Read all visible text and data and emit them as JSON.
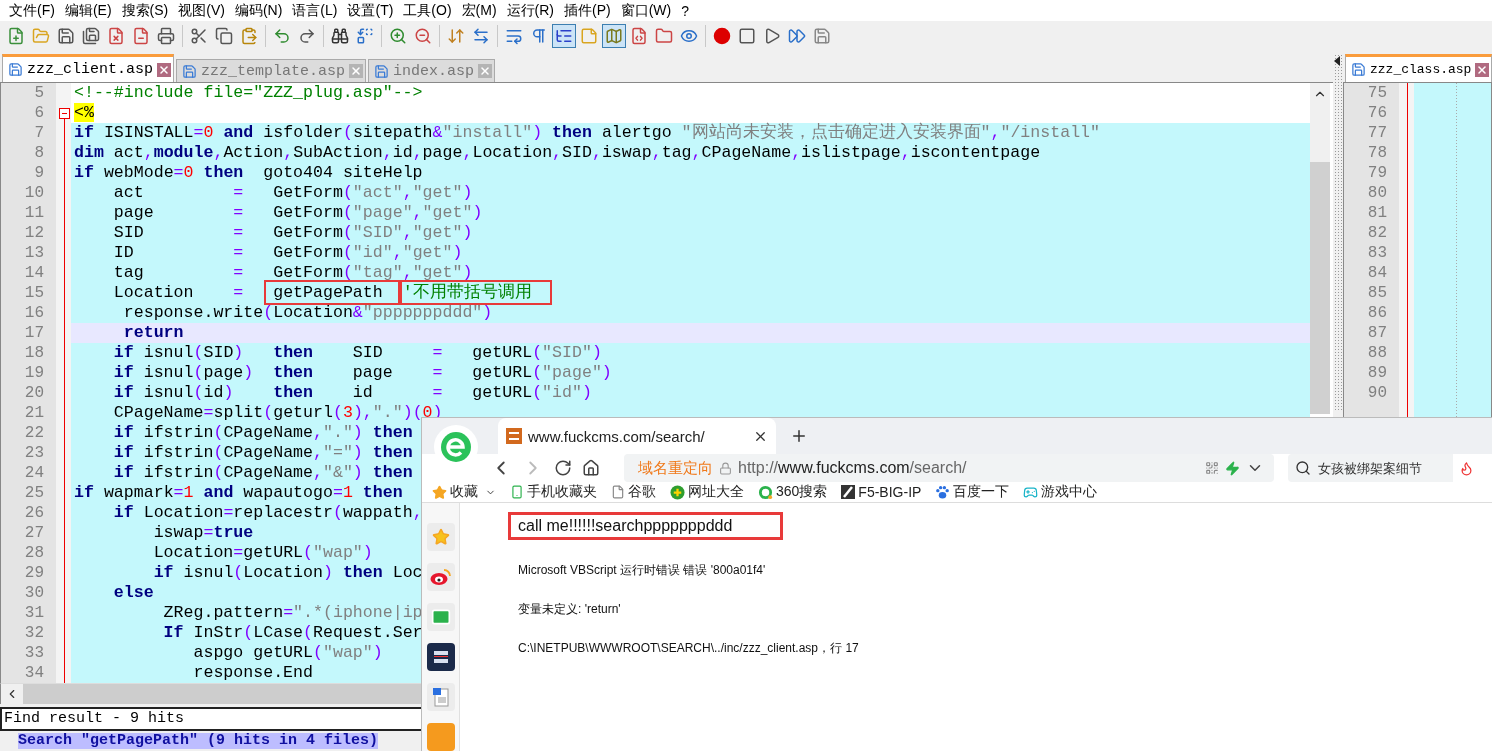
{
  "menu": [
    "文件(F)",
    "编辑(E)",
    "搜索(S)",
    "视图(V)",
    "编码(N)",
    "语言(L)",
    "设置(T)",
    "工具(O)",
    "宏(M)",
    "运行(R)",
    "插件(P)",
    "窗口(W)",
    "?"
  ],
  "toolbar": [
    [
      {
        "kind": "new",
        "pressed": false
      },
      {
        "kind": "open",
        "pressed": false
      },
      {
        "kind": "save",
        "pressed": false
      },
      {
        "kind": "saveall",
        "pressed": false
      },
      {
        "kind": "close",
        "pressed": false
      },
      {
        "kind": "closeall",
        "pressed": false
      },
      {
        "kind": "print",
        "pressed": false
      }
    ],
    [
      {
        "kind": "cut",
        "pressed": false
      },
      {
        "kind": "copy",
        "pressed": false
      },
      {
        "kind": "paste",
        "pressed": false
      }
    ],
    [
      {
        "kind": "undo",
        "pressed": false
      },
      {
        "kind": "redo",
        "pressed": false
      }
    ],
    [
      {
        "kind": "find",
        "pressed": false
      },
      {
        "kind": "replace",
        "pressed": false
      }
    ],
    [
      {
        "kind": "zoomin",
        "pressed": false
      },
      {
        "kind": "zoomout",
        "pressed": false
      }
    ],
    [
      {
        "kind": "syncv",
        "pressed": false
      },
      {
        "kind": "synch",
        "pressed": false
      }
    ],
    [
      {
        "kind": "wrap",
        "pressed": false
      },
      {
        "kind": "chars",
        "pressed": false
      },
      {
        "kind": "guide",
        "pressed": true
      },
      {
        "kind": "note",
        "pressed": false
      },
      {
        "kind": "map",
        "pressed": true
      },
      {
        "kind": "func",
        "pressed": false
      },
      {
        "kind": "folder",
        "pressed": false
      },
      {
        "kind": "eye",
        "pressed": false
      }
    ],
    [
      {
        "kind": "record",
        "pressed": false
      },
      {
        "kind": "stop",
        "pressed": false
      },
      {
        "kind": "play",
        "pressed": false
      },
      {
        "kind": "playmany",
        "pressed": false
      },
      {
        "kind": "savemacro",
        "pressed": false
      }
    ]
  ],
  "tabs": [
    {
      "label": "zzz_client.asp",
      "selected": true
    },
    {
      "label": "zzz_template.asp",
      "selected": false
    },
    {
      "label": "index.asp",
      "selected": false
    }
  ],
  "editor": {
    "lines": [
      {
        "n": "5",
        "embedded": false,
        "current": false,
        "fold": false,
        "tokens": [
          {
            "kind": "markup",
            "text": "<!--#include file=\"ZZZ_plug.asp\"-->"
          }
        ]
      },
      {
        "n": "6",
        "embedded": false,
        "current": false,
        "fold": true,
        "tokens": [
          {
            "kind": "delimiter",
            "text": "<%"
          }
        ]
      },
      {
        "n": "7",
        "embedded": true,
        "current": false,
        "fold": false,
        "tokens": [
          {
            "kind": "keyword",
            "text": "if"
          },
          {
            "kind": "plain",
            "text": " ISINSTALL"
          },
          {
            "kind": "operator",
            "text": "="
          },
          {
            "kind": "number",
            "text": "0"
          },
          {
            "kind": "keyword",
            "text": " and"
          },
          {
            "kind": "plain",
            "text": " isfolder"
          },
          {
            "kind": "operator",
            "text": "("
          },
          {
            "kind": "plain",
            "text": "sitepath"
          },
          {
            "kind": "operator",
            "text": "&"
          },
          {
            "kind": "string",
            "text": "\"install\""
          },
          {
            "kind": "operator",
            "text": ")"
          },
          {
            "kind": "keyword",
            "text": " then"
          },
          {
            "kind": "plain",
            "text": " alertgo "
          },
          {
            "kind": "string",
            "text": "\"网站尚未安装，点击确定进入安装界面\""
          },
          {
            "kind": "operator",
            "text": ","
          },
          {
            "kind": "string",
            "text": "\"/install\""
          }
        ]
      },
      {
        "n": "8",
        "embedded": true,
        "current": false,
        "fold": false,
        "tokens": [
          {
            "kind": "keyword",
            "text": "dim"
          },
          {
            "kind": "plain",
            "text": " act"
          },
          {
            "kind": "operator",
            "text": ","
          },
          {
            "kind": "keyword",
            "text": "module"
          },
          {
            "kind": "operator",
            "text": ","
          },
          {
            "kind": "plain",
            "text": "Action"
          },
          {
            "kind": "operator",
            "text": ","
          },
          {
            "kind": "plain",
            "text": "SubAction"
          },
          {
            "kind": "operator",
            "text": ","
          },
          {
            "kind": "plain",
            "text": "id"
          },
          {
            "kind": "operator",
            "text": ","
          },
          {
            "kind": "plain",
            "text": "page"
          },
          {
            "kind": "operator",
            "text": ","
          },
          {
            "kind": "plain",
            "text": "Location"
          },
          {
            "kind": "operator",
            "text": ","
          },
          {
            "kind": "plain",
            "text": "SID"
          },
          {
            "kind": "operator",
            "text": ","
          },
          {
            "kind": "plain",
            "text": "iswap"
          },
          {
            "kind": "operator",
            "text": ","
          },
          {
            "kind": "plain",
            "text": "tag"
          },
          {
            "kind": "operator",
            "text": ","
          },
          {
            "kind": "plain",
            "text": "CPageName"
          },
          {
            "kind": "operator",
            "text": ","
          },
          {
            "kind": "plain",
            "text": "islistpage"
          },
          {
            "kind": "operator",
            "text": ","
          },
          {
            "kind": "plain",
            "text": "iscontentpage"
          }
        ]
      },
      {
        "n": "9",
        "embedded": true,
        "current": false,
        "fold": false,
        "tokens": [
          {
            "kind": "keyword",
            "text": "if"
          },
          {
            "kind": "plain",
            "text": " webMode"
          },
          {
            "kind": "operator",
            "text": "="
          },
          {
            "kind": "number",
            "text": "0"
          },
          {
            "kind": "keyword",
            "text": " then"
          },
          {
            "kind": "plain",
            "text": "  goto404 siteHelp"
          }
        ]
      },
      {
        "n": "10",
        "embedded": true,
        "current": false,
        "fold": false,
        "tokens": [
          {
            "kind": "plain",
            "text": "    act         "
          },
          {
            "kind": "operator",
            "text": "="
          },
          {
            "kind": "plain",
            "text": "   GetForm"
          },
          {
            "kind": "operator",
            "text": "("
          },
          {
            "kind": "string",
            "text": "\"act\""
          },
          {
            "kind": "operator",
            "text": ","
          },
          {
            "kind": "string",
            "text": "\"get\""
          },
          {
            "kind": "operator",
            "text": ")"
          }
        ]
      },
      {
        "n": "11",
        "embedded": true,
        "current": false,
        "fold": false,
        "tokens": [
          {
            "kind": "plain",
            "text": "    page        "
          },
          {
            "kind": "operator",
            "text": "="
          },
          {
            "kind": "plain",
            "text": "   GetForm"
          },
          {
            "kind": "operator",
            "text": "("
          },
          {
            "kind": "string",
            "text": "\"page\""
          },
          {
            "kind": "operator",
            "text": ","
          },
          {
            "kind": "string",
            "text": "\"get\""
          },
          {
            "kind": "operator",
            "text": ")"
          }
        ]
      },
      {
        "n": "12",
        "embedded": true,
        "current": false,
        "fold": false,
        "tokens": [
          {
            "kind": "plain",
            "text": "    SID         "
          },
          {
            "kind": "operator",
            "text": "="
          },
          {
            "kind": "plain",
            "text": "   GetForm"
          },
          {
            "kind": "operator",
            "text": "("
          },
          {
            "kind": "string",
            "text": "\"SID\""
          },
          {
            "kind": "operator",
            "text": ","
          },
          {
            "kind": "string",
            "text": "\"get\""
          },
          {
            "kind": "operator",
            "text": ")"
          }
        ]
      },
      {
        "n": "13",
        "embedded": true,
        "current": false,
        "fold": false,
        "tokens": [
          {
            "kind": "plain",
            "text": "    ID          "
          },
          {
            "kind": "operator",
            "text": "="
          },
          {
            "kind": "plain",
            "text": "   GetForm"
          },
          {
            "kind": "operator",
            "text": "("
          },
          {
            "kind": "string",
            "text": "\"id\""
          },
          {
            "kind": "operator",
            "text": ","
          },
          {
            "kind": "string",
            "text": "\"get\""
          },
          {
            "kind": "operator",
            "text": ")"
          }
        ]
      },
      {
        "n": "14",
        "embedded": true,
        "current": false,
        "fold": false,
        "tokens": [
          {
            "kind": "plain",
            "text": "    tag         "
          },
          {
            "kind": "operator",
            "text": "="
          },
          {
            "kind": "plain",
            "text": "   GetForm"
          },
          {
            "kind": "operator",
            "text": "("
          },
          {
            "kind": "string",
            "text": "\"tag\""
          },
          {
            "kind": "operator",
            "text": ","
          },
          {
            "kind": "string",
            "text": "\"get\""
          },
          {
            "kind": "operator",
            "text": ")"
          }
        ]
      },
      {
        "n": "15",
        "embedded": true,
        "current": false,
        "fold": false,
        "tokens": [
          {
            "kind": "plain",
            "text": "    Location    "
          },
          {
            "kind": "operator",
            "text": "=   "
          },
          {
            "kind": "plain",
            "text": "getPagePath  ",
            "boxed": true
          },
          {
            "kind": "comment",
            "text": "'不用带括号调用",
            "boxed": true
          }
        ]
      },
      {
        "n": "16",
        "embedded": true,
        "current": false,
        "fold": false,
        "tokens": [
          {
            "kind": "plain",
            "text": "     response.write"
          },
          {
            "kind": "operator",
            "text": "("
          },
          {
            "kind": "plain",
            "text": "Location"
          },
          {
            "kind": "operator",
            "text": "&"
          },
          {
            "kind": "string",
            "text": "\"pppppppddd\""
          },
          {
            "kind": "operator",
            "text": ")"
          }
        ]
      },
      {
        "n": "17",
        "embedded": true,
        "current": true,
        "fold": false,
        "tokens": [
          {
            "kind": "keyword",
            "text": "     return"
          }
        ]
      },
      {
        "n": "18",
        "embedded": true,
        "current": false,
        "fold": false,
        "tokens": [
          {
            "kind": "keyword",
            "text": "    if"
          },
          {
            "kind": "plain",
            "text": " isnul"
          },
          {
            "kind": "operator",
            "text": "("
          },
          {
            "kind": "plain",
            "text": "SID"
          },
          {
            "kind": "operator",
            "text": ")"
          },
          {
            "kind": "keyword",
            "text": "   then"
          },
          {
            "kind": "plain",
            "text": "    SID     "
          },
          {
            "kind": "operator",
            "text": "="
          },
          {
            "kind": "plain",
            "text": "   getURL"
          },
          {
            "kind": "operator",
            "text": "("
          },
          {
            "kind": "string",
            "text": "\"SID\""
          },
          {
            "kind": "operator",
            "text": ")"
          }
        ]
      },
      {
        "n": "19",
        "embedded": true,
        "current": false,
        "fold": false,
        "tokens": [
          {
            "kind": "keyword",
            "text": "    if"
          },
          {
            "kind": "plain",
            "text": " isnul"
          },
          {
            "kind": "operator",
            "text": "("
          },
          {
            "kind": "plain",
            "text": "page"
          },
          {
            "kind": "operator",
            "text": ")"
          },
          {
            "kind": "keyword",
            "text": "  then"
          },
          {
            "kind": "plain",
            "text": "    page    "
          },
          {
            "kind": "operator",
            "text": "="
          },
          {
            "kind": "plain",
            "text": "   getURL"
          },
          {
            "kind": "operator",
            "text": "("
          },
          {
            "kind": "string",
            "text": "\"page\""
          },
          {
            "kind": "operator",
            "text": ")"
          }
        ]
      },
      {
        "n": "20",
        "embedded": true,
        "current": false,
        "fold": false,
        "tokens": [
          {
            "kind": "keyword",
            "text": "    if"
          },
          {
            "kind": "plain",
            "text": " isnul"
          },
          {
            "kind": "operator",
            "text": "("
          },
          {
            "kind": "plain",
            "text": "id"
          },
          {
            "kind": "operator",
            "text": ")"
          },
          {
            "kind": "keyword",
            "text": "    then"
          },
          {
            "kind": "plain",
            "text": "    id      "
          },
          {
            "kind": "operator",
            "text": "="
          },
          {
            "kind": "plain",
            "text": "   getURL"
          },
          {
            "kind": "operator",
            "text": "("
          },
          {
            "kind": "string",
            "text": "\"id\""
          },
          {
            "kind": "operator",
            "text": ")"
          }
        ]
      },
      {
        "n": "21",
        "embedded": true,
        "current": false,
        "fold": false,
        "tokens": [
          {
            "kind": "plain",
            "text": "    CPageName"
          },
          {
            "kind": "operator",
            "text": "="
          },
          {
            "kind": "plain",
            "text": "split"
          },
          {
            "kind": "operator",
            "text": "("
          },
          {
            "kind": "plain",
            "text": "geturl"
          },
          {
            "kind": "operator",
            "text": "("
          },
          {
            "kind": "number",
            "text": "3"
          },
          {
            "kind": "operator",
            "text": "),"
          },
          {
            "kind": "string",
            "text": "\".\""
          },
          {
            "kind": "operator",
            "text": ")("
          },
          {
            "kind": "number",
            "text": "0"
          },
          {
            "kind": "operator",
            "text": ")"
          }
        ]
      },
      {
        "n": "22",
        "embedded": true,
        "current": false,
        "fold": false,
        "tokens": [
          {
            "kind": "keyword",
            "text": "    if"
          },
          {
            "kind": "plain",
            "text": " ifstrin"
          },
          {
            "kind": "operator",
            "text": "("
          },
          {
            "kind": "plain",
            "text": "CPageName"
          },
          {
            "kind": "operator",
            "text": ","
          },
          {
            "kind": "string",
            "text": "\".\""
          },
          {
            "kind": "operator",
            "text": ")"
          },
          {
            "kind": "keyword",
            "text": " then"
          }
        ]
      },
      {
        "n": "23",
        "embedded": true,
        "current": false,
        "fold": false,
        "tokens": [
          {
            "kind": "keyword",
            "text": "    if"
          },
          {
            "kind": "plain",
            "text": " ifstrin"
          },
          {
            "kind": "operator",
            "text": "("
          },
          {
            "kind": "plain",
            "text": "CPageName"
          },
          {
            "kind": "operator",
            "text": ","
          },
          {
            "kind": "string",
            "text": "\"=\""
          },
          {
            "kind": "operator",
            "text": ")"
          },
          {
            "kind": "keyword",
            "text": " then"
          }
        ]
      },
      {
        "n": "24",
        "embedded": true,
        "current": false,
        "fold": false,
        "tokens": [
          {
            "kind": "keyword",
            "text": "    if"
          },
          {
            "kind": "plain",
            "text": " ifstrin"
          },
          {
            "kind": "operator",
            "text": "("
          },
          {
            "kind": "plain",
            "text": "CPageName"
          },
          {
            "kind": "operator",
            "text": ","
          },
          {
            "kind": "string",
            "text": "\"&\""
          },
          {
            "kind": "operator",
            "text": ")"
          },
          {
            "kind": "keyword",
            "text": " then"
          }
        ]
      },
      {
        "n": "25",
        "embedded": true,
        "current": false,
        "fold": false,
        "tokens": [
          {
            "kind": "keyword",
            "text": "if"
          },
          {
            "kind": "plain",
            "text": " wapmark"
          },
          {
            "kind": "operator",
            "text": "="
          },
          {
            "kind": "number",
            "text": "1"
          },
          {
            "kind": "keyword",
            "text": " and"
          },
          {
            "kind": "plain",
            "text": " wapautogo"
          },
          {
            "kind": "operator",
            "text": "="
          },
          {
            "kind": "number",
            "text": "1"
          },
          {
            "kind": "keyword",
            "text": " then"
          }
        ]
      },
      {
        "n": "26",
        "embedded": true,
        "current": false,
        "fold": false,
        "tokens": [
          {
            "kind": "keyword",
            "text": "    if"
          },
          {
            "kind": "plain",
            "text": " Location"
          },
          {
            "kind": "operator",
            "text": "="
          },
          {
            "kind": "plain",
            "text": "replacestr"
          },
          {
            "kind": "operator",
            "text": "("
          },
          {
            "kind": "plain",
            "text": "wappath"
          },
          {
            "kind": "operator",
            "text": ","
          }
        ]
      },
      {
        "n": "27",
        "embedded": true,
        "current": false,
        "fold": false,
        "tokens": [
          {
            "kind": "plain",
            "text": "        iswap"
          },
          {
            "kind": "operator",
            "text": "="
          },
          {
            "kind": "keyword",
            "text": "true"
          }
        ]
      },
      {
        "n": "28",
        "embedded": true,
        "current": false,
        "fold": false,
        "tokens": [
          {
            "kind": "plain",
            "text": "        Location"
          },
          {
            "kind": "operator",
            "text": "="
          },
          {
            "kind": "plain",
            "text": "getURL"
          },
          {
            "kind": "operator",
            "text": "("
          },
          {
            "kind": "string",
            "text": "\"wap\""
          },
          {
            "kind": "operator",
            "text": ")"
          }
        ]
      },
      {
        "n": "29",
        "embedded": true,
        "current": false,
        "fold": false,
        "tokens": [
          {
            "kind": "keyword",
            "text": "        if"
          },
          {
            "kind": "plain",
            "text": " isnul"
          },
          {
            "kind": "operator",
            "text": "("
          },
          {
            "kind": "plain",
            "text": "Location"
          },
          {
            "kind": "operator",
            "text": ")"
          },
          {
            "kind": "keyword",
            "text": " then"
          },
          {
            "kind": "plain",
            "text": " Loc"
          }
        ]
      },
      {
        "n": "30",
        "embedded": true,
        "current": false,
        "fold": false,
        "tokens": [
          {
            "kind": "keyword",
            "text": "    else"
          }
        ]
      },
      {
        "n": "31",
        "embedded": true,
        "current": false,
        "fold": false,
        "tokens": [
          {
            "kind": "plain",
            "text": "         ZReg.pattern"
          },
          {
            "kind": "operator",
            "text": "="
          },
          {
            "kind": "string",
            "text": "\".*(iphone|ip"
          }
        ]
      },
      {
        "n": "32",
        "embedded": true,
        "current": false,
        "fold": false,
        "tokens": [
          {
            "kind": "keyword",
            "text": "         If"
          },
          {
            "kind": "plain",
            "text": " InStr"
          },
          {
            "kind": "operator",
            "text": "("
          },
          {
            "kind": "plain",
            "text": "LCase"
          },
          {
            "kind": "operator",
            "text": "("
          },
          {
            "kind": "plain",
            "text": "Request.Ser"
          }
        ]
      },
      {
        "n": "33",
        "embedded": true,
        "current": false,
        "fold": false,
        "tokens": [
          {
            "kind": "plain",
            "text": "            aspgo getURL"
          },
          {
            "kind": "operator",
            "text": "("
          },
          {
            "kind": "string",
            "text": "\"wap\""
          },
          {
            "kind": "operator",
            "text": ")"
          }
        ]
      },
      {
        "n": "34",
        "embedded": true,
        "current": false,
        "fold": false,
        "tokens": [
          {
            "kind": "plain",
            "text": "            response.End"
          }
        ]
      }
    ]
  },
  "second_view": {
    "tab": {
      "label": "zzz_class.asp",
      "selected": true
    },
    "line_numbers": [
      "75",
      "76",
      "77",
      "78",
      "79",
      "80",
      "81",
      "82",
      "83",
      "84",
      "85",
      "86",
      "87",
      "88",
      "89",
      "90"
    ]
  },
  "find_result": {
    "title": "Find result - 9 hits",
    "search_line": "Search \"getPagePath\" (9 hits in 4 files)"
  },
  "browser": {
    "tab": {
      "title": "www.fuckcms.com/search/"
    },
    "address": {
      "notice": "域名重定向",
      "url": "http://www.fuckcms.com/search/"
    },
    "search": {
      "placeholder": "女孩被绑架案细节"
    },
    "bookmarks": [
      {
        "label": "收藏",
        "kind": "favorites"
      },
      {
        "label": "手机收藏夹",
        "kind": "phone"
      },
      {
        "label": "谷歌",
        "kind": "page"
      },
      {
        "label": "网址大全",
        "kind": "plus"
      },
      {
        "label": "360搜索",
        "kind": "ring"
      },
      {
        "label": "F5-BIG-IP",
        "kind": "slash"
      },
      {
        "label": "百度一下",
        "kind": "paw"
      },
      {
        "label": "游戏中心",
        "kind": "game"
      }
    ],
    "sidebar": [
      {
        "kind": "star"
      },
      {
        "kind": "weibo"
      },
      {
        "kind": "mail"
      },
      {
        "kind": "app"
      },
      {
        "kind": "doc"
      },
      {
        "kind": "orange"
      }
    ],
    "output": {
      "text": "call me!!!!!!searchpppppppddd",
      "boxed": true
    },
    "messages": [
      "Microsoft VBScript 运行时错误 错误 '800a01f4'",
      "变量未定义: 'return'",
      "C:\\INETPUB\\WWWROOT\\SEARCH\\../inc/zzz_client.asp，行 17"
    ]
  }
}
